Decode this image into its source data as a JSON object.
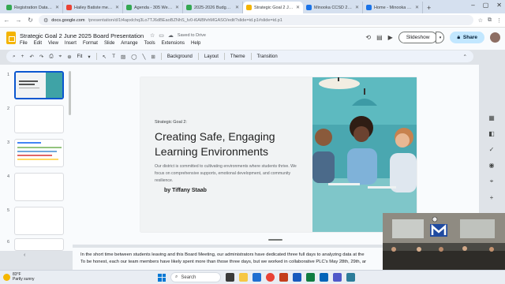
{
  "browser": {
    "tabs": [
      {
        "label": "Registration Data 7t...",
        "fav_color": "#34a853",
        "active": false
      },
      {
        "label": "Hailey Batiste messag...",
        "fav_color": "#ea4335",
        "active": false
      },
      {
        "label": "Agenda - 305 West C...",
        "fav_color": "#34a853",
        "active": false
      },
      {
        "label": "2025-2026 Budget -...",
        "fav_color": "#34a853",
        "active": false
      },
      {
        "label": "Strategic Goal 2 June ...",
        "fav_color": "#f4b400",
        "active": true
      },
      {
        "label": "Minooka CCSD 201 S...",
        "fav_color": "#1a73e8",
        "active": false
      },
      {
        "label": "Home - Minooka CCS...",
        "fav_color": "#1a73e8",
        "active": false
      }
    ],
    "new_tab": "+",
    "url_domain": "docs.google.com",
    "url_rest": "/presentation/d/1t4apxlchq3Lo7TJ6dBEaoBZNhS_lv0-i6AlBfvhMGASO/edit?slide=id.p1#slide=id.p1"
  },
  "doc": {
    "title": "Strategic Goal 2 June 2025 Board Presentation",
    "saved_status": "Saved to Drive",
    "menu": [
      "File",
      "Edit",
      "View",
      "Insert",
      "Format",
      "Slide",
      "Arrange",
      "Tools",
      "Extensions",
      "Help"
    ],
    "slideshow_label": "Slideshow",
    "share_label": "Share"
  },
  "toolbar": {
    "zoom": "Fit",
    "background": "Background",
    "layout": "Layout",
    "theme": "Theme",
    "transition": "Transition"
  },
  "filmstrip": {
    "numbers": [
      "1",
      "2",
      "3",
      "4",
      "5",
      "6"
    ]
  },
  "slide": {
    "subtitle": "Strategic Goal 2:",
    "title": "Creating Safe, Engaging Learning Environments",
    "body": "Our district is committed to cultivating environments where students thrive. We focus on comprehensive supports, emotional development, and community resilience.",
    "author": "by Tiffany Staab"
  },
  "notes": {
    "line1": "In the short time between students leaving and this Board Meeting, our administrators have dedicated three full days to analyzing data at the",
    "line2": "To be honest, each our team members have likely spent more than those three days, but we worked in collaborative PLC's May 28th, 29th, ar"
  },
  "taskbar": {
    "temp": "83°F",
    "condition": "Partly sunny",
    "search": "Search"
  }
}
